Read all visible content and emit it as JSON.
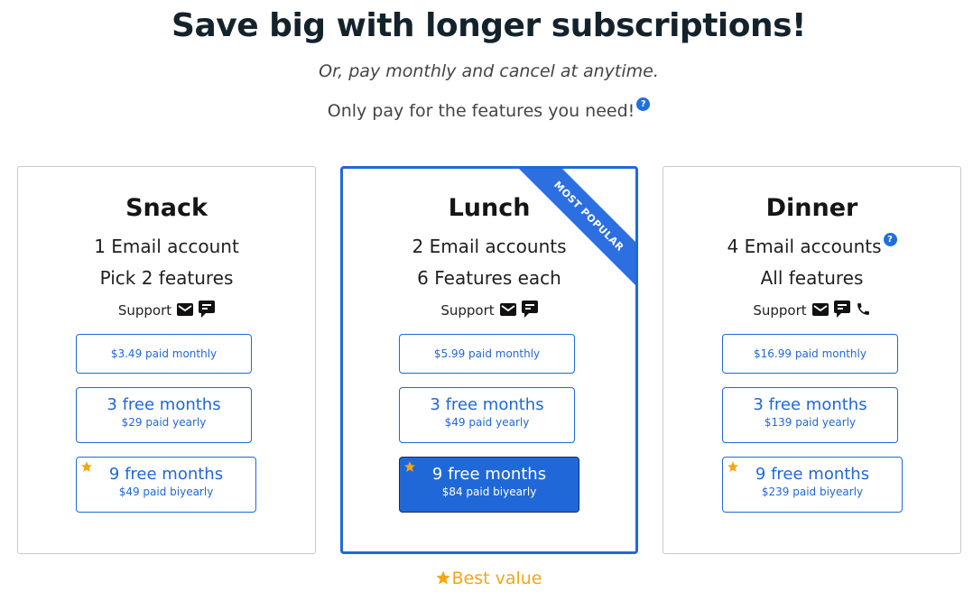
{
  "header": {
    "title": "Save big with longer subscriptions!",
    "subtitle": "Or, pay monthly and cancel at anytime.",
    "subtitle2": "Only pay for the features you need!",
    "help_glyph": "?"
  },
  "colors": {
    "accent": "#2068d8",
    "star": "#f3a712",
    "title": "#14232b"
  },
  "plans": [
    {
      "name": "Snack",
      "accounts": "1 Email account",
      "features": "Pick 2 features",
      "support_label": "Support",
      "support_icons": [
        "email-icon",
        "chat-icon"
      ],
      "monthly": "$3.49 paid monthly",
      "yearly_title": "3 free months",
      "yearly_price": "$29 paid yearly",
      "biyearly_title": "9 free months",
      "biyearly_price": "$49 paid biyearly"
    },
    {
      "name": "Lunch",
      "accounts": "2 Email accounts",
      "features": "6 Features each",
      "support_label": "Support",
      "support_icons": [
        "email-icon",
        "chat-icon"
      ],
      "ribbon": "MOST POPULAR",
      "monthly": "$5.99 paid monthly",
      "yearly_title": "3 free months",
      "yearly_price": "$49 paid yearly",
      "biyearly_title": "9 free months",
      "biyearly_price": "$84 paid biyearly"
    },
    {
      "name": "Dinner",
      "accounts": "4 Email accounts",
      "features": "All features",
      "support_label": "Support",
      "support_icons": [
        "email-icon",
        "chat-icon",
        "phone-icon"
      ],
      "monthly": "$16.99 paid monthly",
      "yearly_title": "3 free months",
      "yearly_price": "$139 paid yearly",
      "biyearly_title": "9 free months",
      "biyearly_price": "$239 paid biyearly"
    }
  ],
  "footer": {
    "best_value": "Best value"
  }
}
